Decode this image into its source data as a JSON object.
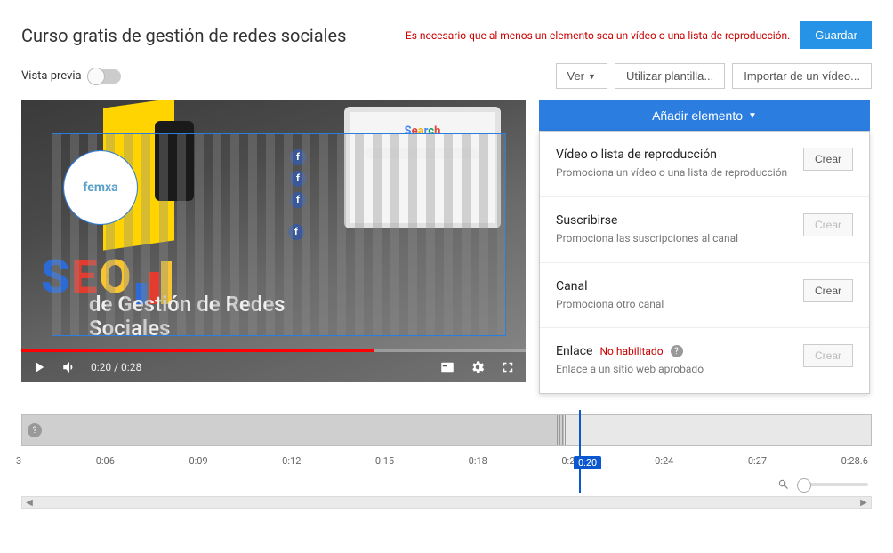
{
  "header": {
    "title": "Curso gratis de gestión de redes sociales",
    "error": "Es necesario que al menos un elemento sea un vídeo o una lista de reproducción.",
    "save": "Guardar"
  },
  "toolbar": {
    "preview_label": "Vista previa",
    "view": "Ver",
    "template": "Utilizar plantilla...",
    "import": "Importar de un vídeo..."
  },
  "video": {
    "search_word": "Search",
    "overlay_line1": "de Gestión de Redes",
    "overlay_line2": "Sociales",
    "logo_text": "femxa",
    "time_current": "0:20",
    "time_total": "0:28"
  },
  "add_button": "Añadir elemento",
  "elements": [
    {
      "title": "Vídeo o lista de reproducción",
      "desc": "Promociona un vídeo o una lista de reproducción",
      "action": "Crear",
      "disabled": false
    },
    {
      "title": "Suscribirse",
      "desc": "Promociona las suscripciones al canal",
      "action": "Crear",
      "disabled": true
    },
    {
      "title": "Canal",
      "desc": "Promociona otro canal",
      "action": "Crear",
      "disabled": false
    },
    {
      "title": "Enlace",
      "badge": "No habilitado",
      "desc": "Enlace a un sitio web aprobado",
      "action": "Crear",
      "disabled": true
    }
  ],
  "timeline": {
    "playhead": "0:20",
    "ticks": [
      "3",
      "0:06",
      "0:09",
      "0:12",
      "0:15",
      "0:18",
      "0:21",
      "0:24",
      "0:27",
      "0:28.6"
    ]
  }
}
